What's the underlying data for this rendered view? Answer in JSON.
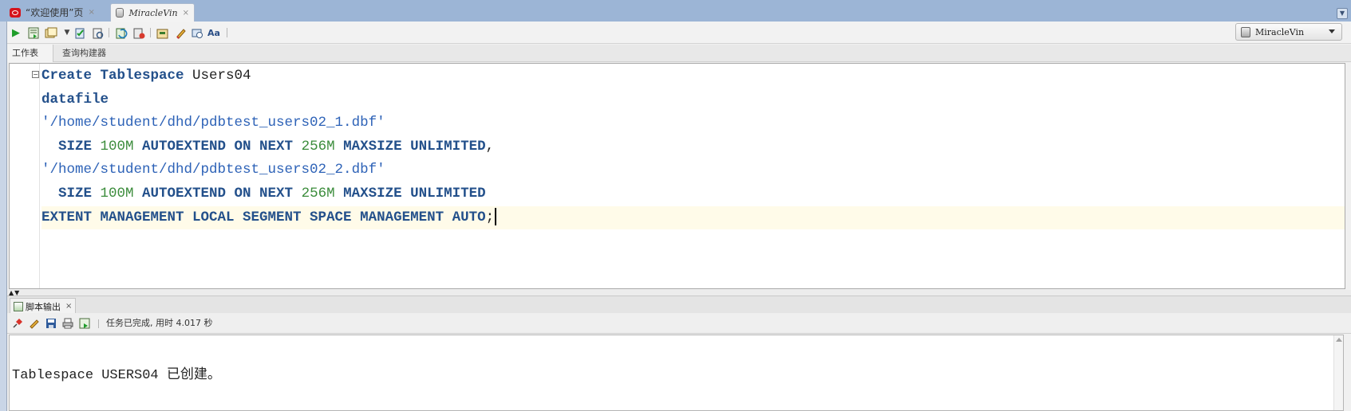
{
  "doc_tabs": [
    {
      "label": "“欢迎使用”页",
      "close": "×",
      "icon": "oracle-icon"
    },
    {
      "label": "MiracleVin",
      "close": "×",
      "icon": "database-icon"
    }
  ],
  "connection_selector": {
    "value": "MiracleVin"
  },
  "sub_tabs": {
    "worksheet": "工作表",
    "query_builder": "查询构建器"
  },
  "editor": {
    "fold_marker": "−",
    "lines": [
      [
        {
          "t": "Create Tablespace",
          "c": "kw"
        },
        {
          "t": " Users04",
          "c": "plain"
        }
      ],
      [
        {
          "t": "datafile",
          "c": "kw"
        }
      ],
      [
        {
          "t": "'/home/student/dhd/pdbtest_users02_1.dbf'",
          "c": "str"
        }
      ],
      [
        {
          "t": "  SIZE ",
          "c": "kw"
        },
        {
          "t": "100M",
          "c": "num"
        },
        {
          "t": " AUTOEXTEND ON NEXT ",
          "c": "kw"
        },
        {
          "t": "256M",
          "c": "num"
        },
        {
          "t": " MAXSIZE UNLIMITED",
          "c": "kw"
        },
        {
          "t": ",",
          "c": "plain"
        }
      ],
      [
        {
          "t": "'/home/student/dhd/pdbtest_users02_2.dbf'",
          "c": "str"
        }
      ],
      [
        {
          "t": "  SIZE ",
          "c": "kw"
        },
        {
          "t": "100M",
          "c": "num"
        },
        {
          "t": " AUTOEXTEND ON NEXT ",
          "c": "kw"
        },
        {
          "t": "256M",
          "c": "num"
        },
        {
          "t": " MAXSIZE UNLIMITED",
          "c": "kw"
        }
      ],
      [
        {
          "t": "EXTENT MANAGEMENT LOCAL SEGMENT SPACE MANAGEMENT AUTO",
          "c": "kw"
        },
        {
          "t": ";",
          "c": "plain"
        }
      ]
    ],
    "current_line": 6
  },
  "output": {
    "tab_label": "脚本输出",
    "tab_close": "×",
    "status": "任务已完成, 用时 4.017 秒",
    "text": "Tablespace USERS04 已创建。"
  },
  "colors": {
    "keyword": "#23508b",
    "string": "#2d62b7",
    "number": "#3b8c3b",
    "current_line": "#fffbe9"
  }
}
